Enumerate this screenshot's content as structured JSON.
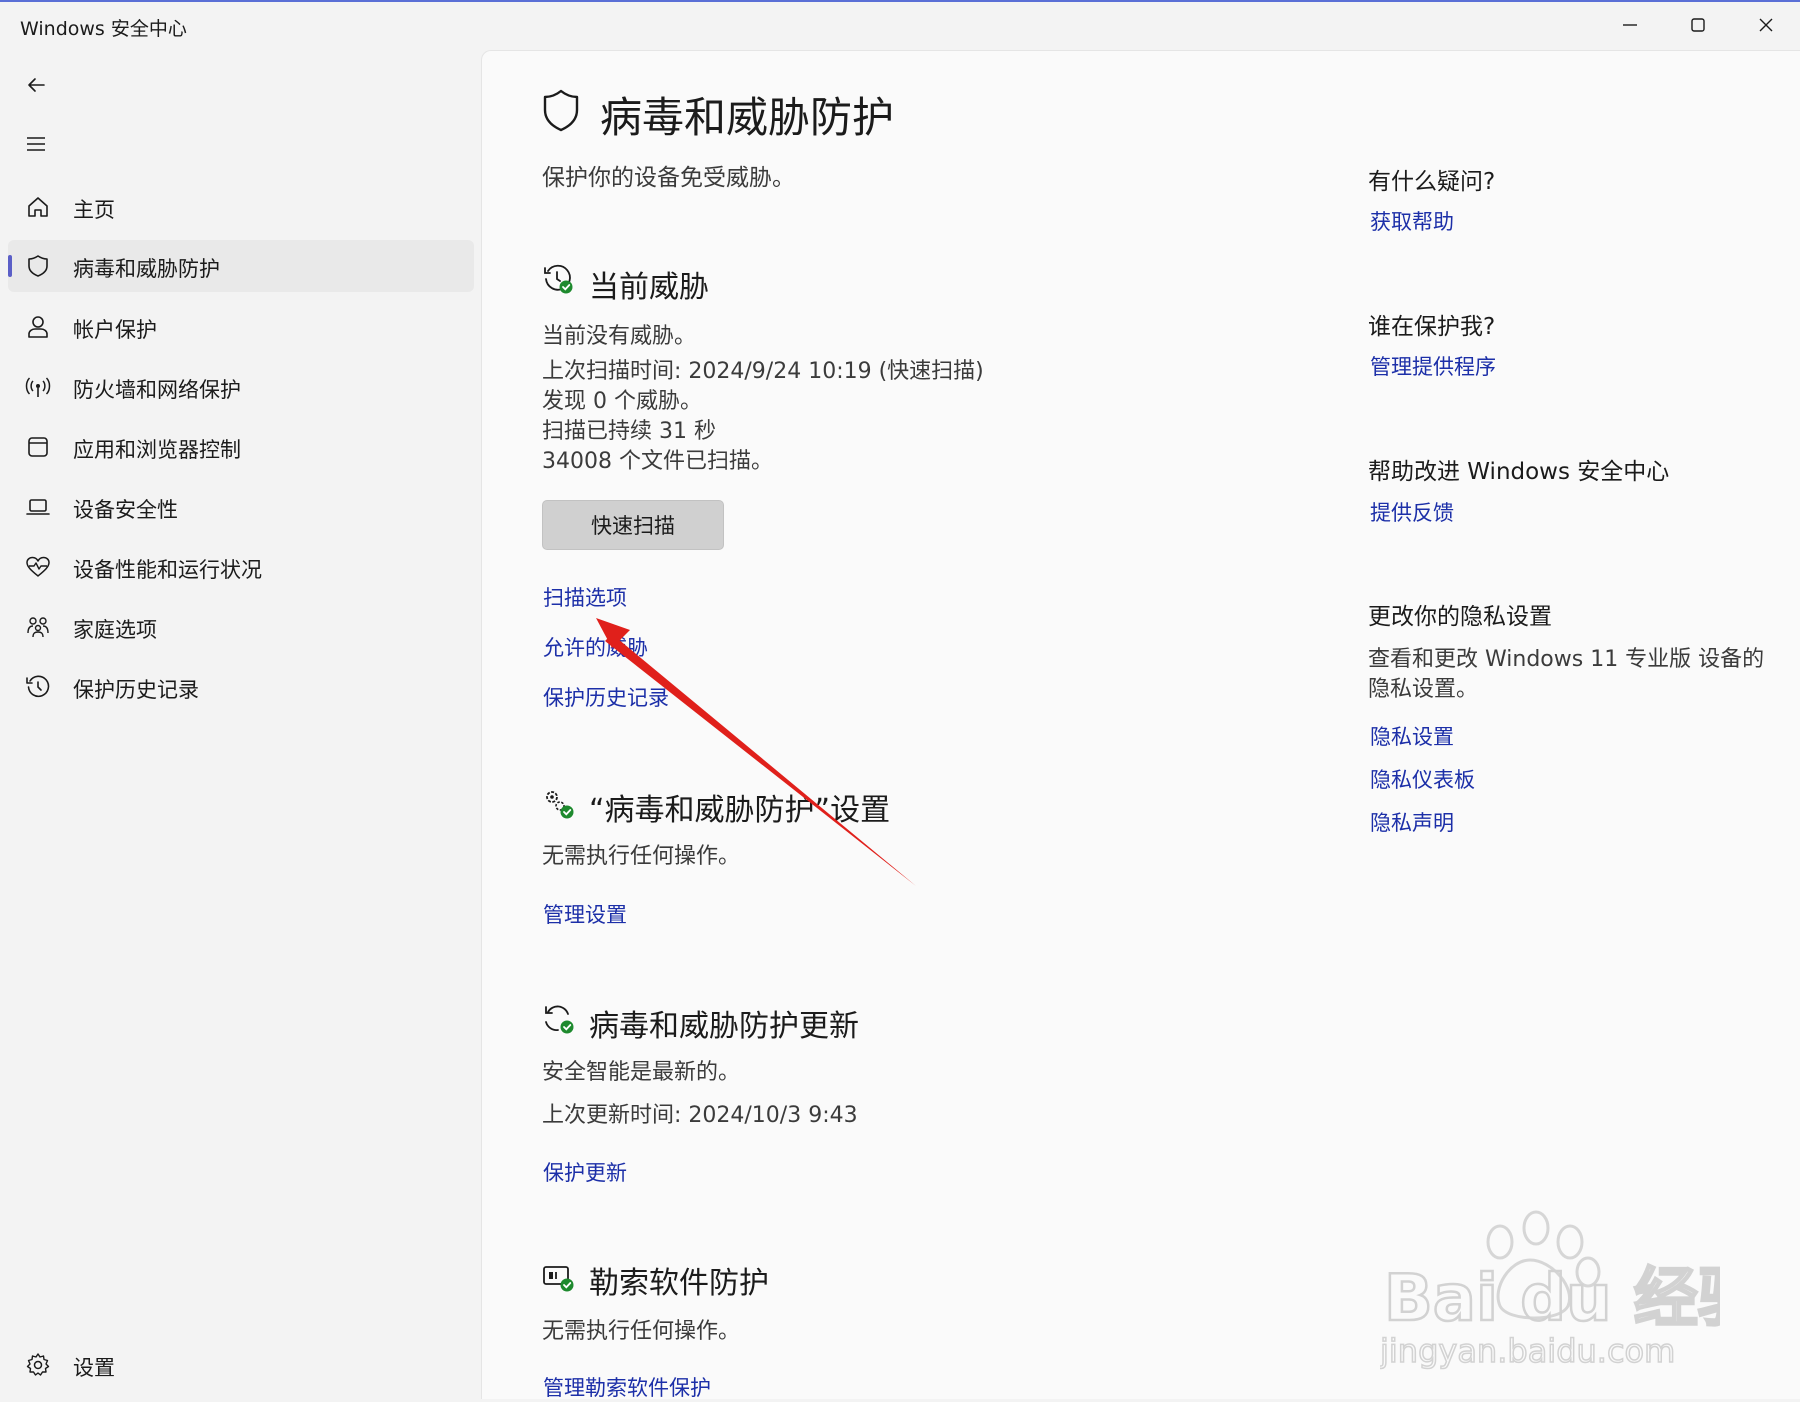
{
  "window": {
    "title": "Windows 安全中心",
    "controls": [
      "minimize-icon",
      "maximize-icon",
      "close-icon"
    ]
  },
  "sidebar": {
    "items": [
      {
        "label": "主页",
        "icon": "home-icon"
      },
      {
        "label": "病毒和威胁防护",
        "icon": "shield-icon",
        "active": true
      },
      {
        "label": "帐户保护",
        "icon": "person-icon"
      },
      {
        "label": "防火墙和网络保护",
        "icon": "wireless-icon"
      },
      {
        "label": "应用和浏览器控制",
        "icon": "app-window-icon"
      },
      {
        "label": "设备安全性",
        "icon": "laptop-icon"
      },
      {
        "label": "设备性能和运行状况",
        "icon": "heart-pulse-icon"
      },
      {
        "label": "家庭选项",
        "icon": "family-icon"
      },
      {
        "label": "保护历史记录",
        "icon": "history-icon"
      }
    ],
    "settings_label": "设置"
  },
  "page": {
    "title": "病毒和威胁防护",
    "subtitle": "保护你的设备免受威胁。"
  },
  "current_threats": {
    "title": "当前威胁",
    "lines": [
      "当前没有威胁。",
      "上次扫描时间: 2024/9/24 10:19 (快速扫描)",
      "发现 0 个威胁。",
      "扫描已持续 31 秒",
      "34008 个文件已扫描。"
    ],
    "button": "快速扫描",
    "links": [
      "扫描选项",
      "允许的威胁",
      "保护历史记录"
    ]
  },
  "settings_section": {
    "title": "“病毒和威胁防护”设置",
    "text": "无需执行任何操作。",
    "link": "管理设置"
  },
  "updates_section": {
    "title": "病毒和威胁防护更新",
    "lines": [
      "安全智能是最新的。",
      "上次更新时间: 2024/10/3 9:43"
    ],
    "link": "保护更新"
  },
  "ransomware_section": {
    "title": "勒索软件防护",
    "text": "无需执行任何操作。",
    "link": "管理勒索软件保护"
  },
  "right_panel": {
    "help": {
      "heading": "有什么疑问?",
      "link": "获取帮助"
    },
    "protector": {
      "heading": "谁在保护我?",
      "link": "管理提供程序"
    },
    "improve": {
      "heading": "帮助改进 Windows 安全中心",
      "link": "提供反馈"
    },
    "privacy": {
      "heading": "更改你的隐私设置",
      "text": "查看和更改 Windows 11 专业版 设备的隐私设置。",
      "links": [
        "隐私设置",
        "隐私仪表板",
        "隐私声明"
      ]
    }
  },
  "watermark": {
    "brand": "Bai du 经验",
    "url": "jingyan.baidu.com"
  },
  "colors": {
    "accent": "#5b5fc7",
    "link": "#1c2fa8",
    "status_ok": "#1e8a2e",
    "arrow": "#e0201b"
  }
}
